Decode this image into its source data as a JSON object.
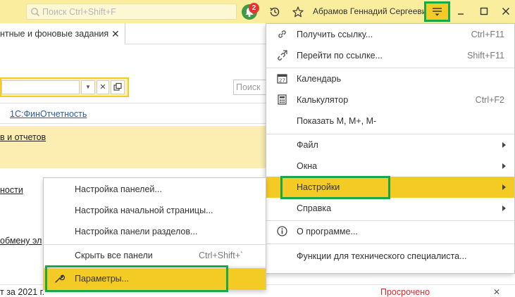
{
  "topbar": {
    "search_placeholder": "Поиск Ctrl+Shift+F",
    "notifications_count": "2",
    "user_name": "Абрамов Геннадий Сергеевич"
  },
  "tab": {
    "title": "нтные и фоновые задания"
  },
  "fields": {
    "right_search_placeholder": "Поиск"
  },
  "content": {
    "link_finreport": "1С:ФинОтчетность",
    "link_reports": "в и отчетов",
    "link_nosti": "ности",
    "link_exchange": "обмену эл",
    "bottom_text": "т за 2021 г.",
    "status_overdue": "Просрочено",
    "close_glyph": "✕"
  },
  "main_menu": {
    "items": [
      {
        "label": "Получить ссылку...",
        "shortcut": "Ctrl+F11"
      },
      {
        "label": "Перейти по ссылке...",
        "shortcut": "Shift+F11"
      },
      {
        "label": "Календарь"
      },
      {
        "label": "Калькулятор",
        "shortcut": "Ctrl+F2"
      },
      {
        "label": "Показать М, М+, М-"
      },
      {
        "label": "Файл"
      },
      {
        "label": "Окна"
      },
      {
        "label": "Настройки"
      },
      {
        "label": "Справка"
      },
      {
        "label": "О программе..."
      },
      {
        "label": "Функции для технического специалиста..."
      }
    ]
  },
  "settings_submenu": {
    "items": [
      {
        "label": "Настройка панелей..."
      },
      {
        "label": "Настройка начальной страницы..."
      },
      {
        "label": "Настройка панели разделов..."
      },
      {
        "label": "Скрыть все панели",
        "shortcut": "Ctrl+Shift+`"
      },
      {
        "label": "Параметры..."
      }
    ]
  },
  "colors": {
    "accent_yellow": "#f3cb24",
    "topbar_yellow": "#fbed9e",
    "highlight_green": "#17a84a",
    "overdue_red": "#d42a2a",
    "link_blue": "#2d5aa0"
  },
  "icons": {
    "search": "search-icon",
    "notifications": "bell-icon",
    "history": "history-icon",
    "favorites": "star-icon",
    "main_menu": "hamburger-menu-icon",
    "link": "link-icon",
    "goto_link": "goto-link-icon",
    "calendar": "calendar-icon",
    "calculator": "calculator-icon",
    "about": "info-icon",
    "parameters": "wrench-icon"
  }
}
